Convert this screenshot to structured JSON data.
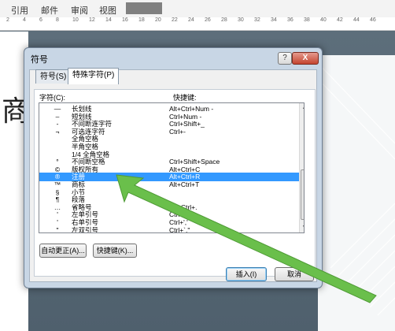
{
  "ribbon": {
    "tabs": [
      "引用",
      "邮件",
      "审阅",
      "视图"
    ]
  },
  "ruler": {
    "ticks": [
      "2",
      "4",
      "6",
      "8",
      "10",
      "12",
      "14",
      "16",
      "18",
      "20",
      "22",
      "24",
      "26",
      "28",
      "30",
      "32",
      "34",
      "36",
      "38",
      "40",
      "42",
      "44",
      "46"
    ]
  },
  "slide": {
    "char": "商"
  },
  "dialog": {
    "title": "符号",
    "help_label": "?",
    "close_label": "X",
    "tabs": [
      "符号(S)",
      "特殊字符(P)"
    ],
    "col_char": "字符(C):",
    "col_shortcut": "快捷键:",
    "rows": [
      {
        "sym": "—",
        "name": "长划线",
        "key": "Alt+Ctrl+Num -"
      },
      {
        "sym": "–",
        "name": "短划线",
        "key": "Ctrl+Num -"
      },
      {
        "sym": "-",
        "name": "不间断连字符",
        "key": "Ctrl+Shift+_"
      },
      {
        "sym": "¬",
        "name": "可选连字符",
        "key": "Ctrl+-"
      },
      {
        "sym": "",
        "name": "全角空格",
        "key": ""
      },
      {
        "sym": "",
        "name": "半角空格",
        "key": ""
      },
      {
        "sym": "",
        "name": "1/4 全角空格",
        "key": ""
      },
      {
        "sym": "°",
        "name": "不间断空格",
        "key": "Ctrl+Shift+Space"
      },
      {
        "sym": "©",
        "name": "版权所有",
        "key": "Alt+Ctrl+C"
      },
      {
        "sym": "®",
        "name": "注册",
        "key": "Alt+Ctrl+R"
      },
      {
        "sym": "™",
        "name": "商标",
        "key": "Alt+Ctrl+T"
      },
      {
        "sym": "§",
        "name": "小节",
        "key": ""
      },
      {
        "sym": "¶",
        "name": "段落",
        "key": ""
      },
      {
        "sym": "…",
        "name": "省略号",
        "key": "Alt+Ctrl+."
      },
      {
        "sym": "'",
        "name": "左单引号",
        "key": "Ctrl+`,`"
      },
      {
        "sym": "'",
        "name": "右单引号",
        "key": "Ctrl+','"
      },
      {
        "sym": "\"",
        "name": "左双引号",
        "key": "Ctrl+`,\""
      }
    ],
    "selected_index": 9,
    "autocorrect_button": "自动更正(A)...",
    "shortcut_button": "快捷键(K)...",
    "insert_button": "插入(I)",
    "cancel_button": "取消"
  },
  "colors": {
    "selection": "#3399ff",
    "arrow": "#6abf4b"
  }
}
